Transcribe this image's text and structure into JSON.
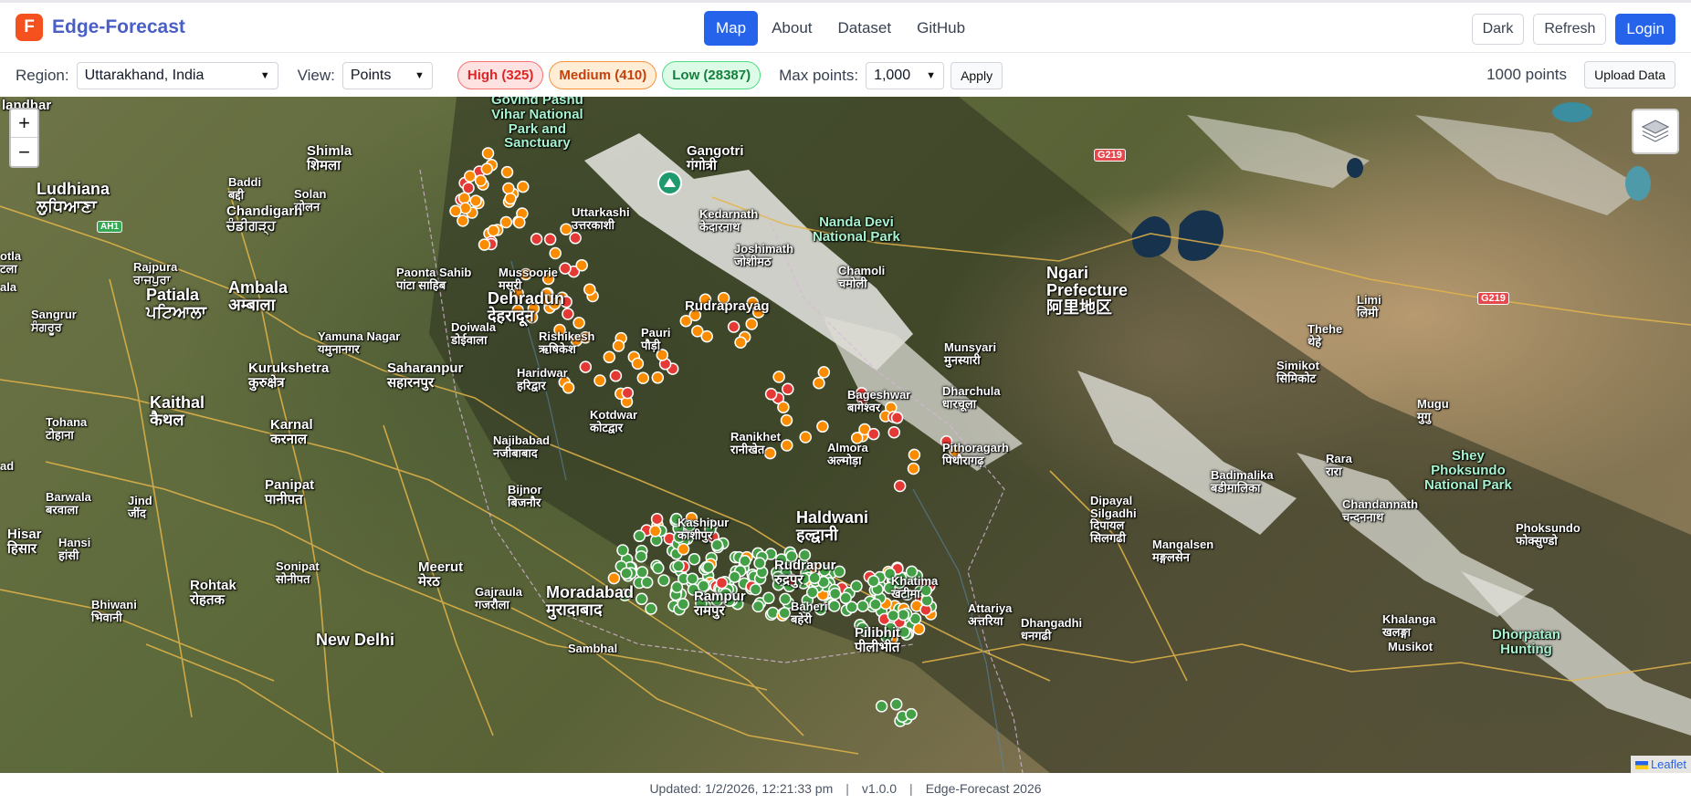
{
  "header": {
    "logo_letter": "F",
    "app_name": "Edge-Forecast",
    "nav": [
      "Map",
      "About",
      "Dataset",
      "GitHub"
    ],
    "dark_label": "Dark",
    "refresh_label": "Refresh",
    "login_label": "Login"
  },
  "toolbar": {
    "region_label": "Region:",
    "region_value": "Uttarakhand, India",
    "view_label": "View:",
    "view_value": "Points",
    "pills": {
      "high": "High (325)",
      "medium": "Medium (410)",
      "low": "Low (28387)"
    },
    "max_points_label": "Max points:",
    "max_points_value": "1,000",
    "apply_label": "Apply",
    "count_text": "1000 points",
    "upload_label": "Upload Data"
  },
  "map": {
    "zoom_in": "+",
    "zoom_out": "−",
    "attribution": "Leaflet",
    "colors": {
      "high": "#e53935",
      "medium": "#fb8c00",
      "low": "#43a047"
    },
    "road_tags": {
      "g219_a": "G219",
      "g219_b": "G219",
      "ah1": "AH1"
    },
    "labels": {
      "jalandhar": "landhar",
      "ludhiana": "Ludhiana\nਲੁਧਿਆਣਾ",
      "shimla": "Shimla\nशिमला",
      "baddi": "Baddi\nबद्दी",
      "solan": "Solan\nसोलन",
      "chandigarh": "Chandigarh\nਚੰਡੀਗੜ੍ਹ",
      "kotla": "otla\nटला",
      "rajpura": "Rajpura\nਰਾਜਪੁਰਾ",
      "patiala": "Patiala\nਪਟਿਆਲਾ",
      "ambala": "Ambala\nअम्बाला",
      "paonta": "Paonta Sahib\nपांटा साहिब",
      "sangrur": "Sangrur\nਸੰਗਰੂਰ",
      "ala": "ala",
      "yamuna": "Yamuna Nagar\nयमुनानगर",
      "kurukshetra": "Kurukshetra\nकुरुक्षेत्र",
      "saharanpur": "Saharanpur\nसहारनपुर",
      "kaithal": "Kaithal\nकैथल",
      "tohana": "Tohana\nटोहाना",
      "karnal": "Karnal\nकरनाल",
      "panipat": "Panipat\nपानीपत",
      "jind": "Jind\nजींद",
      "barwala": "Barwala\nबरवाला",
      "hisar": "Hisar\nहिसार",
      "hansi": "Hansi\nहांसी",
      "sonipat": "Sonipat\nसोनीपत",
      "rohtak": "Rohtak\nरोहतक",
      "bhiwani": "Bhiwani\nभिवानी",
      "newdelhi": "New Delhi",
      "meerut": "Meerut\nमेरठ",
      "ad": "ad",
      "govind": "Govind Pashu\nVihar National\nPark and\nSanctuary",
      "gangotri": "Gangotri\nगंगोत्री",
      "uttarkashi": "Uttarkashi\nउत्तरकाशी",
      "kedarnath": "Kedarnath\nकेदारनाथ",
      "nandadevi": "Nanda Devi\nNational Park",
      "joshimath": "Joshimath\nजोशीमठ",
      "chamoli": "Chamoli\nचमोली",
      "mussoorie": "Mussoorie\nमसूरी",
      "dehradun": "Dehradun\nदेहरादून",
      "doiwala": "Doiwala\nडोईवाला",
      "rishikesh": "Rishikesh\nऋषिकेश",
      "pauri": "Pauri\nपौड़ी",
      "rudraprayag": "Rudraprayag",
      "haridwar": "Haridwar\nहरिद्वार",
      "bageshwar": "Bageshwar\nबागेश्वर",
      "dharchula": "Dharchula\nधारचूला",
      "munsyari": "Munsyari\nमुनस्यारी",
      "kotdwar": "Kotdwar\nकोटद्वार",
      "najibabad": "Najibabad\nनजीबाबाद",
      "ranikhet": "Ranikhet\nरानीखेत",
      "almora": "Almora\nअल्मोड़ा",
      "pithoragarh": "Pithoragarh\nपिथौरागढ़",
      "bijnor": "Bijnor\nबिजनौर",
      "haldwani": "Haldwani\nहल्द्वानी",
      "kashipur": "Kashipur\nकाशीपुर",
      "rudrapur": "Rudrapur\nरुद्रपुर",
      "gajraula": "Gajraula\nगजरौला",
      "moradabad": "Moradabad\nमुरादाबाद",
      "rampur": "Rampur\nरामपुर",
      "baheri": "Baheri\nबहेरी",
      "pilibhit": "Pilibhit\nपीलीभीत",
      "sambhal": "Sambhal",
      "khatima": "Khatima\nखटीमा",
      "attariya": "Attariya\nअत्तरिया",
      "dhangadhi": "Dhangadhi\nधनगढी",
      "ngari": "Ngari\nPrefecture\n阿里地区",
      "limi": "Limi\nलिमी",
      "thehe": "Thehe\nथेहे",
      "simikot": "Simikot\nसिमिकोट",
      "mugu": "Mugu\nमुगु",
      "rara": "Rara\nरारा",
      "shey": "Shey\nPhoksundo\nNational Park",
      "badimalika": "Badimalika\nबडीमालिका",
      "dipayal": "Dipayal\nSilgadhi\nदिपायल\nसिलगढी",
      "chandannath": "Chandannath\nचन्दननाथ",
      "mangalsen": "Mangalsen\nमङ्गलसेन",
      "phoksundo": "Phoksundo\nफोक्सुण्डो",
      "khalanga": "Khalanga\nखलङ्गा",
      "musikot": "Musikot",
      "dhorpatan": "Dhorpatan\nHunting"
    }
  },
  "footer": {
    "updated": "Updated: 1/2/2026, 12:21:33 pm",
    "version": "v1.0.0",
    "copyright": "Edge-Forecast 2026"
  }
}
